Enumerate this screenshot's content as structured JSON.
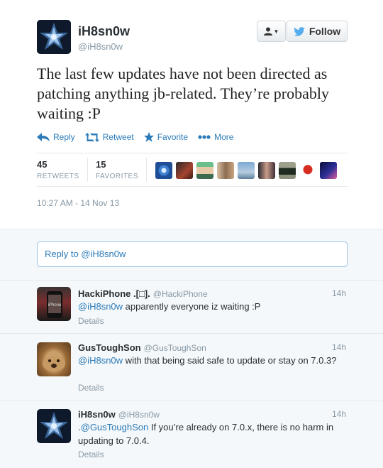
{
  "author": {
    "name": "iH8sn0w",
    "handle": "@iH8sn0w"
  },
  "buttons": {
    "user_menu_icon": "user-dropdown-icon",
    "follow_label": "Follow"
  },
  "tweet": {
    "text": "The last few updates have not been directed as patching anything jb-related. They’re probably waiting :P",
    "timestamp": "10:27 AM - 14 Nov 13"
  },
  "actions": {
    "reply": "Reply",
    "retweet": "Retweet",
    "favorite": "Favorite",
    "more": "More"
  },
  "stats": {
    "retweets_count": "45",
    "retweets_label": "RETWEETS",
    "favorites_count": "15",
    "favorites_label": "FAVORITES"
  },
  "reply_box": {
    "placeholder": "Reply to @iH8sn0w"
  },
  "replies": [
    {
      "name": "HackiPhone .[□].",
      "handle": "@HackiPhone",
      "time": "14h",
      "mention": "@iH8sn0w",
      "text": " apparently everyone iz waiting :P",
      "details": "Details"
    },
    {
      "name": "GusToughSon",
      "handle": "@GusToughSon",
      "time": "14h",
      "mention": "@iH8sn0w",
      "text": " with that being said safe to update or stay on 7.0.3?",
      "details": "Details"
    },
    {
      "name": "iH8sn0w",
      "handle": "@iH8sn0w",
      "time": "14h",
      "prefix": ".",
      "mention": "@GusToughSon",
      "text": " If you’re already on 7.0.x, there is no harm in updating to 7.0.4.",
      "details": "Details"
    }
  ],
  "colors": {
    "link": "#2b7bb9",
    "muted": "#8899a6",
    "retweet_icon": "#5c913b"
  }
}
